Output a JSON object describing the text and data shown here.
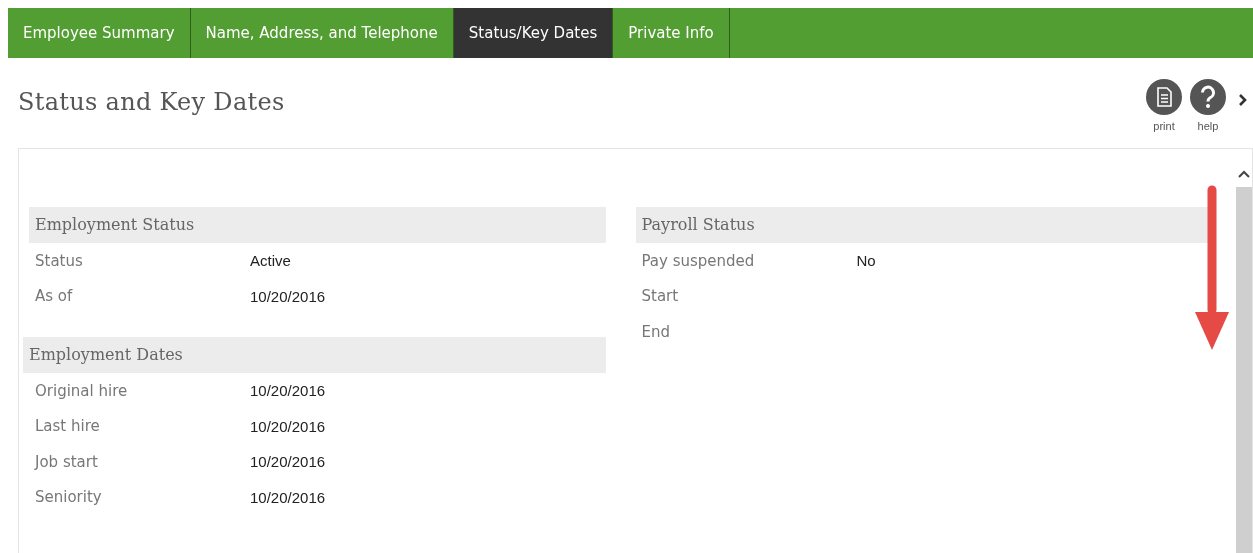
{
  "tabs": [
    {
      "label": "Employee Summary",
      "selected": false
    },
    {
      "label": "Name, Address, and Telephone",
      "selected": false
    },
    {
      "label": "Status/Key Dates",
      "selected": true
    },
    {
      "label": "Private Info",
      "selected": false
    }
  ],
  "page_title": "Status and Key Dates",
  "actions": [
    {
      "kind": "print",
      "label": "print"
    },
    {
      "kind": "help",
      "label": "help"
    }
  ],
  "columns": [
    [
      {
        "title": "Employment Status",
        "rows": [
          {
            "label": "Status",
            "value": "Active"
          },
          {
            "label": "As of",
            "value": "10/20/2016"
          }
        ]
      },
      {
        "title": "Employment Dates",
        "rows": [
          {
            "label": "Original hire",
            "value": "10/20/2016"
          },
          {
            "label": "Last hire",
            "value": "10/20/2016"
          },
          {
            "label": "Job start",
            "value": "10/20/2016"
          },
          {
            "label": "Seniority",
            "value": "10/20/2016"
          }
        ]
      }
    ],
    [
      {
        "title": "Payroll Status",
        "rows": [
          {
            "label": "Pay suspended",
            "value": "No"
          },
          {
            "label": "Start"
          },
          {
            "label": "End"
          }
        ]
      }
    ]
  ]
}
